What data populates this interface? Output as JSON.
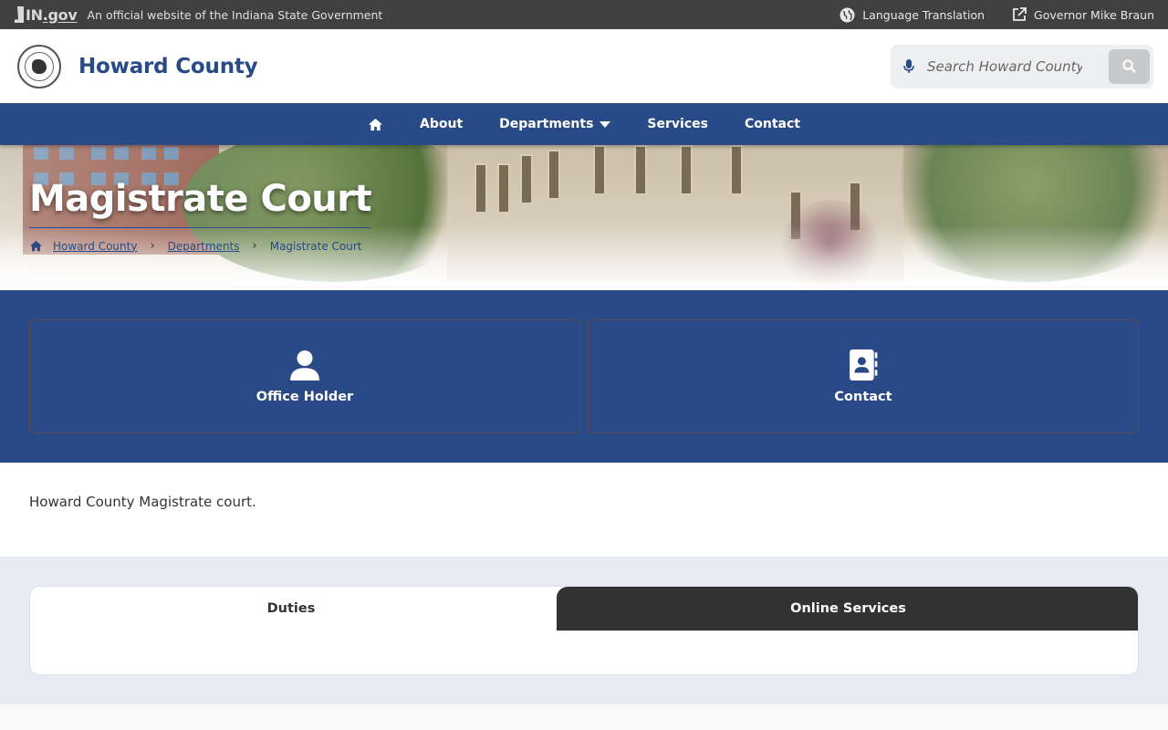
{
  "state_bar": {
    "logo_in": "IN",
    "logo_gov": ".gov",
    "official_text": "An official website of the Indiana State Government",
    "language_label": "Language Translation",
    "governor_label": "Governor Mike Braun"
  },
  "header": {
    "site_title": "Howard County",
    "search_placeholder": "Search Howard County"
  },
  "nav": {
    "items": [
      {
        "label": "About"
      },
      {
        "label": "Departments"
      },
      {
        "label": "Services"
      },
      {
        "label": "Contact"
      }
    ]
  },
  "hero": {
    "title": "Magistrate Court",
    "breadcrumb": [
      {
        "label": "Howard County"
      },
      {
        "label": "Departments"
      },
      {
        "label": "Magistrate Court"
      }
    ]
  },
  "quick_links": [
    {
      "label": "Office Holder",
      "icon": "user-icon"
    },
    {
      "label": "Contact",
      "icon": "address-book-icon"
    }
  ],
  "description": "Howard County Magistrate court.",
  "tabs": [
    {
      "label": "Duties"
    },
    {
      "label": "Online Services"
    }
  ],
  "colors": {
    "brand_blue": "#284a86",
    "state_bar": "#404040",
    "active_tab": "#323232"
  }
}
